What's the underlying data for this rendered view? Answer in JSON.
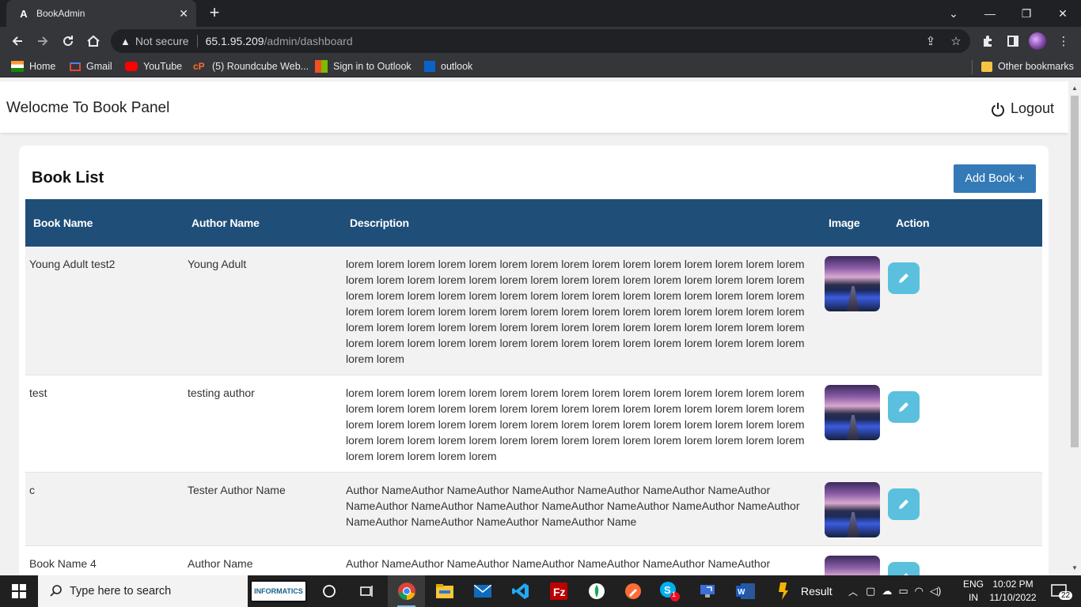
{
  "browser": {
    "tab_title": "BookAdmin",
    "tab_favicon": "A",
    "security_label": "Not secure",
    "url_host": "65.1.95.209",
    "url_path": "/admin/dashboard",
    "bookmarks": [
      "Home",
      "Gmail",
      "YouTube",
      "(5) Roundcube Web...",
      "Sign in to Outlook",
      "outlook"
    ],
    "other_bookmarks": "Other bookmarks"
  },
  "header": {
    "welcome": "Welocme To Book Panel",
    "logout_label": "Logout"
  },
  "book_list": {
    "title": "Book List",
    "add_button": "Add Book +",
    "columns": [
      "Book Name",
      "Author Name",
      "Description",
      "Image",
      "Action"
    ],
    "rows": [
      {
        "name": "Young Adult test2",
        "author": "Young Adult",
        "description": "lorem lorem lorem lorem lorem lorem lorem lorem lorem lorem lorem lorem lorem lorem lorem lorem lorem lorem lorem lorem lorem lorem lorem lorem lorem lorem lorem lorem lorem lorem lorem lorem lorem lorem lorem lorem lorem lorem lorem lorem lorem lorem lorem lorem lorem lorem lorem lorem lorem lorem lorem lorem lorem lorem lorem lorem lorem lorem lorem lorem lorem lorem lorem lorem lorem lorem lorem lorem lorem lorem lorem lorem lorem lorem lorem lorem lorem lorem lorem lorem lorem lorem lorem lorem lorem lorem lorem lorem lorem lorem lorem lorem"
      },
      {
        "name": "test",
        "author": "testing author",
        "description": "lorem lorem lorem lorem lorem lorem lorem lorem lorem lorem lorem lorem lorem lorem lorem lorem lorem lorem lorem lorem lorem lorem lorem lorem lorem lorem lorem lorem lorem lorem lorem lorem lorem lorem lorem lorem lorem lorem lorem lorem lorem lorem lorem lorem lorem lorem lorem lorem lorem lorem lorem lorem lorem lorem lorem lorem lorem lorem lorem lorem lorem lorem lorem lorem lorem"
      },
      {
        "name": "c",
        "author": "Tester Author Name",
        "description": "Author NameAuthor NameAuthor NameAuthor NameAuthor NameAuthor NameAuthor NameAuthor NameAuthor NameAuthor NameAuthor NameAuthor NameAuthor NameAuthor NameAuthor NameAuthor NameAuthor NameAuthor Name"
      },
      {
        "name": "Book Name 4",
        "author": "Author Name",
        "description": "Author NameAuthor NameAuthor NameAuthor NameAuthor NameAuthor NameAuthor NameAuthor NameAuthor NameAuthor NameAuthor NameAuthor NameAuthor NameAuthor NameAuthor NameAuthor NameAuthor NameAuthor Name"
      }
    ]
  },
  "taskbar": {
    "search_placeholder": "Type here to search",
    "infor_label": "INFORMATICS",
    "result_label": "Result",
    "language_top": "ENG",
    "language_bottom": "IN",
    "time": "10:02 PM",
    "date": "11/10/2022",
    "notification_count": "22",
    "skype_badge": "1"
  },
  "colors": {
    "table_header": "#1f4e79",
    "add_button": "#337ab7",
    "edit_button": "#5bc0de"
  }
}
